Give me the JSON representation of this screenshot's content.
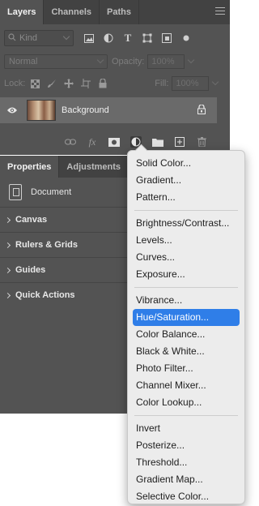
{
  "layers_panel": {
    "tabs": [
      "Layers",
      "Channels",
      "Paths"
    ],
    "kind_placeholder": "Kind",
    "blend_mode": "Normal",
    "opacity_label": "Opacity:",
    "opacity_value": "100%",
    "lock_label": "Lock:",
    "fill_label": "Fill:",
    "fill_value": "100%",
    "layer_name": "Background"
  },
  "properties_panel": {
    "tabs": [
      "Properties",
      "Adjustments"
    ],
    "document_label": "Document",
    "sections": [
      "Canvas",
      "Rulers & Grids",
      "Guides",
      "Quick Actions"
    ]
  },
  "adjustment_menu": {
    "groups": [
      [
        "Solid Color...",
        "Gradient...",
        "Pattern..."
      ],
      [
        "Brightness/Contrast...",
        "Levels...",
        "Curves...",
        "Exposure..."
      ],
      [
        "Vibrance...",
        "Hue/Saturation...",
        "Color Balance...",
        "Black & White...",
        "Photo Filter...",
        "Channel Mixer...",
        "Color Lookup..."
      ],
      [
        "Invert",
        "Posterize...",
        "Threshold...",
        "Gradient Map...",
        "Selective Color..."
      ]
    ],
    "selected": "Hue/Saturation..."
  },
  "colors": {
    "panel_bg": "#535353",
    "tab_bg": "#424242",
    "menu_bg": "#ececec",
    "selection": "#2f7ee8"
  }
}
